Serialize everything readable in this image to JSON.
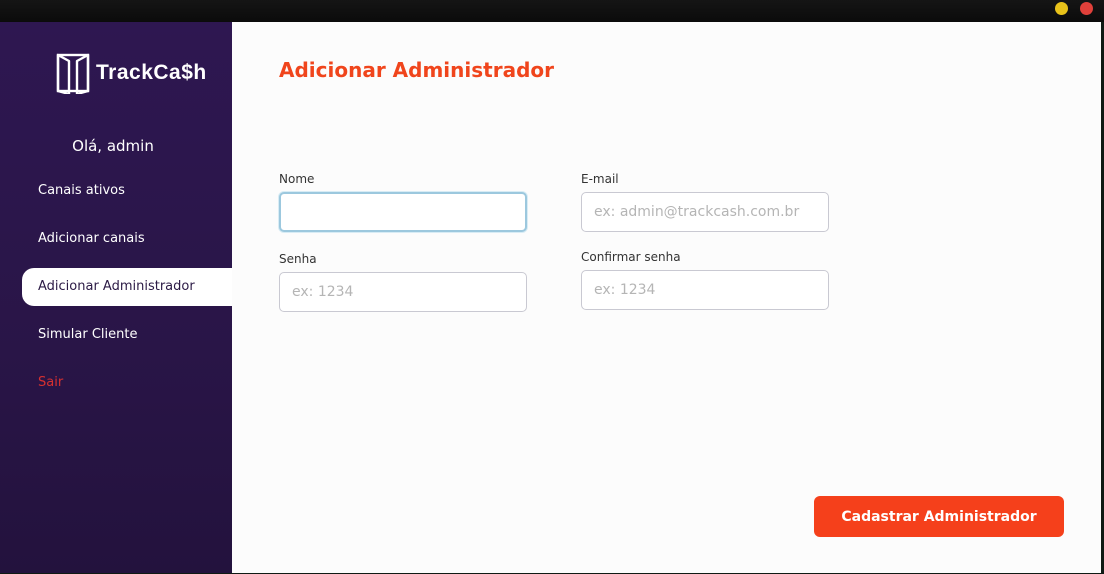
{
  "app": {
    "logo_text": "TrackCa$h",
    "greeting": "Olá, admin"
  },
  "sidebar": {
    "items": [
      {
        "label": "Canais ativos",
        "active": false
      },
      {
        "label": "Adicionar canais",
        "active": false
      },
      {
        "label": "Adicionar Administrador",
        "active": true
      },
      {
        "label": "Simular Cliente",
        "active": false
      },
      {
        "label": "Sair",
        "active": false,
        "color": "#d63030"
      }
    ]
  },
  "main": {
    "title": "Adicionar Administrador",
    "fields": {
      "nome": {
        "label": "Nome",
        "value": "",
        "placeholder": ""
      },
      "email": {
        "label": "E-mail",
        "value": "",
        "placeholder": "ex: admin@trackcash.com.br"
      },
      "senha": {
        "label": "Senha",
        "value": "",
        "placeholder": "ex: 1234"
      },
      "confirmar_senha": {
        "label": "Confirmar senha",
        "value": "",
        "placeholder": "ex: 1234"
      }
    },
    "submit_label": "Cadastrar Administrador"
  },
  "colors": {
    "sidebar_bg": "#2b1650",
    "accent": "#f5401b",
    "danger": "#d63030",
    "focus_border": "#9cc8de"
  },
  "icons": [
    "trackcash-logo-icon"
  ]
}
